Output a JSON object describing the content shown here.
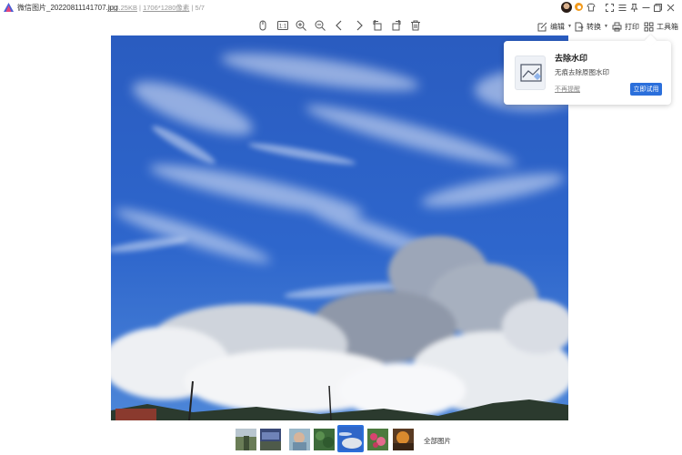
{
  "app": {
    "filename": "微信图片_20220811141707.jpg",
    "file_size": "133.25KB",
    "dimensions": "1706*1280像素",
    "position": "5/7"
  },
  "toolbar": {
    "icons": [
      "hand-tool-icon",
      "actual-size-icon",
      "zoom-in-icon",
      "zoom-out-icon",
      "previous-icon",
      "next-icon",
      "rotate-left-icon",
      "rotate-right-icon",
      "delete-icon"
    ],
    "edit_label": "编辑",
    "convert_label": "转换",
    "print_label": "打印",
    "toolbox_label": "工具箱"
  },
  "window_controls": [
    "fullscreen-icon",
    "menu-icon",
    "pin-icon",
    "minimize-icon",
    "maximize-icon",
    "close-icon"
  ],
  "popup": {
    "title": "去除水印",
    "description": "无痕去除原图水印",
    "dismiss_label": "不再提醒",
    "cta_label": "立即试用"
  },
  "thumbnails": {
    "count": 7,
    "selected_index": 4,
    "all_label": "全部图片"
  },
  "colors": {
    "accent": "#2b6fdb",
    "sky": "#2f66c8"
  }
}
